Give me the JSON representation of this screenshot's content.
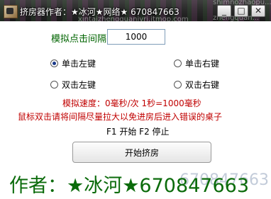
{
  "window": {
    "title": "挤房器作者：★冰河★网络★ 670847663",
    "watermark_left": "xintaizhengquanjyrj.itmop.com",
    "watermark_right_top": "shimnozhaopu...",
    "watermark_right_bottom": "zhengquan...",
    "controls": {
      "minimize": "_",
      "maximize": "□",
      "close": "✕"
    }
  },
  "form": {
    "interval_label": "模拟点击间隔",
    "interval_value": "1000",
    "radios": [
      {
        "label": "单击左键",
        "checked": true
      },
      {
        "label": "单击右键",
        "checked": false
      },
      {
        "label": "双击左键",
        "checked": false
      },
      {
        "label": "双击右键",
        "checked": false
      }
    ],
    "speed_text": "模拟速度：0毫秒/次  1秒=1000毫秒",
    "warning_text": "鼠标双击请将间隔尽量拉大以免进房后进入错误的桌子",
    "hotkey_text": "F1 开始  F2 停止",
    "start_button": "开始挤房"
  },
  "footer": {
    "author_text": "作者：★冰河★670847663",
    "author_ghost": "670847663"
  },
  "colors": {
    "green_label": "#006400",
    "red_text": "#c00000",
    "author_green": "#0b6b0b"
  }
}
